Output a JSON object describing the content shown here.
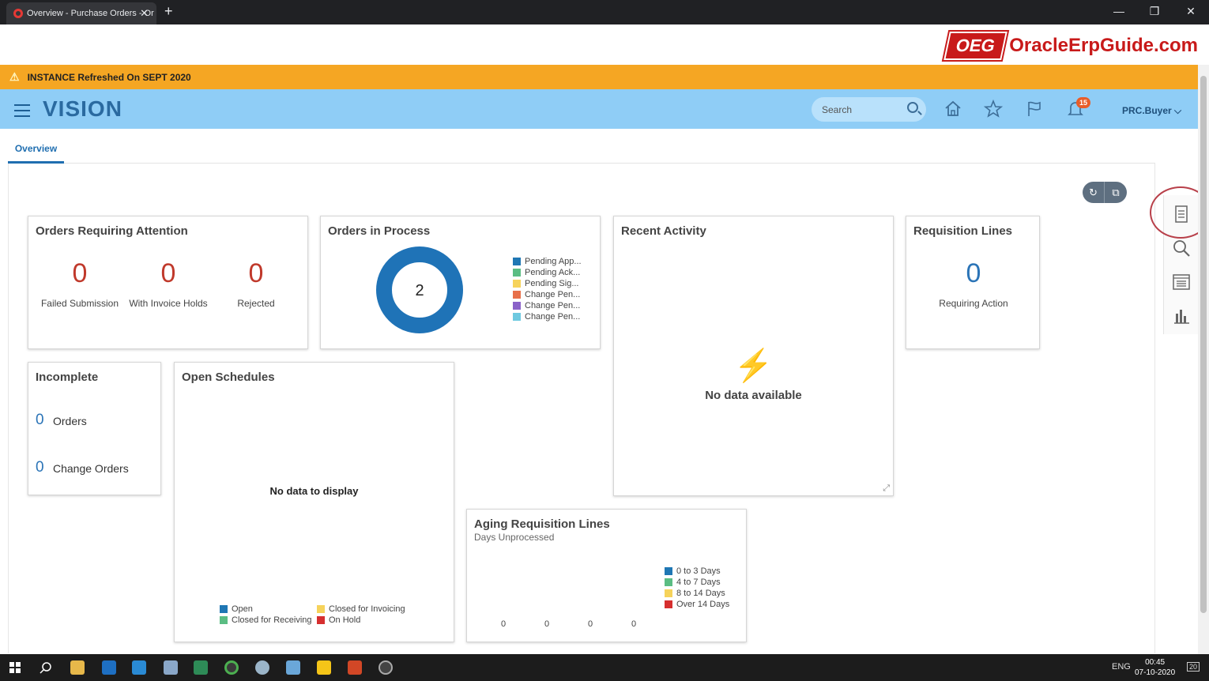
{
  "browser": {
    "tab_title": "Overview - Purchase Orders - Or",
    "close_glyph": "✕",
    "new_tab_glyph": "+",
    "window_controls": [
      "—",
      "❐",
      "✕"
    ]
  },
  "banner": {
    "logo_box": "OEG",
    "logo_text": "OracleErpGuide.com"
  },
  "warning": {
    "icon": "⚠",
    "text": "INSTANCE Refreshed On SEPT 2020"
  },
  "header": {
    "brand": "VISION",
    "search_placeholder": "Search",
    "notifications_count": "15",
    "user": "PRC.Buyer ⌵",
    "icons": [
      "home-icon",
      "star-icon",
      "flag-icon",
      "bell-icon"
    ]
  },
  "tabs": {
    "overview": "Overview"
  },
  "toolbar": {
    "refresh_glyph": "↻",
    "copy_glyph": "⧉"
  },
  "cards": {
    "orders_attention": {
      "title": "Orders Requiring Attention",
      "metrics": [
        {
          "value": "0",
          "label": "Failed Submission"
        },
        {
          "value": "0",
          "label": "With Invoice Holds"
        },
        {
          "value": "0",
          "label": "Rejected"
        }
      ]
    },
    "orders_in_process": {
      "title": "Orders in Process",
      "center_value": "2",
      "legend": [
        {
          "label": "Pending App...",
          "color": "#1f77b4"
        },
        {
          "label": "Pending Ack...",
          "color": "#5bbd83"
        },
        {
          "label": "Pending Sig...",
          "color": "#f6d35b"
        },
        {
          "label": "Change Pen...",
          "color": "#e8704a"
        },
        {
          "label": "Change Pen...",
          "color": "#8a62c9"
        },
        {
          "label": "Change Pen...",
          "color": "#6ec9e0"
        }
      ]
    },
    "recent_activity": {
      "title": "Recent Activity",
      "empty_icon": "⚡",
      "empty_text": "No data available"
    },
    "requisition_lines": {
      "title": "Requisition Lines",
      "value": "0",
      "label": "Requiring Action"
    },
    "incomplete": {
      "title": "Incomplete",
      "rows": [
        {
          "value": "0",
          "label": "Orders"
        },
        {
          "value": "0",
          "label": "Change Orders"
        }
      ]
    },
    "open_schedules": {
      "title": "Open Schedules",
      "empty_text": "No data to display",
      "legend": [
        {
          "label": "Open",
          "color": "#1f77b4"
        },
        {
          "label": "Closed for Invoicing",
          "color": "#f6d35b"
        },
        {
          "label": "Closed for Receiving",
          "color": "#5bbd83"
        },
        {
          "label": "On Hold",
          "color": "#d62f2f"
        }
      ]
    },
    "aging_requisition": {
      "title": "Aging Requisition Lines",
      "subtitle": "Days Unprocessed",
      "legend": [
        {
          "label": "0 to 3 Days",
          "color": "#1f77b4"
        },
        {
          "label": "4 to 7 Days",
          "color": "#5bbd83"
        },
        {
          "label": "8 to 14 Days",
          "color": "#f6d35b"
        },
        {
          "label": "Over 14 Days",
          "color": "#d62f2f"
        }
      ]
    }
  },
  "chart_data": [
    {
      "type": "pie",
      "title": "Orders in Process",
      "categories": [
        "Pending App...",
        "Pending Ack...",
        "Pending Sig...",
        "Change Pen...",
        "Change Pen...",
        "Change Pen..."
      ],
      "values": [
        2,
        0,
        0,
        0,
        0,
        0
      ]
    },
    {
      "type": "bar",
      "title": "Aging Requisition Lines",
      "subtitle": "Days Unprocessed",
      "categories": [
        "0 to 3 Days",
        "4 to 7 Days",
        "8 to 14 Days",
        "Over 14 Days"
      ],
      "values": [
        0,
        0,
        0,
        0
      ],
      "value_labels": [
        "0",
        "0",
        "0",
        "0"
      ]
    }
  ],
  "taskbar": {
    "lang": "ENG",
    "time": "00:45",
    "date": "07-10-2020",
    "notif": "20"
  }
}
